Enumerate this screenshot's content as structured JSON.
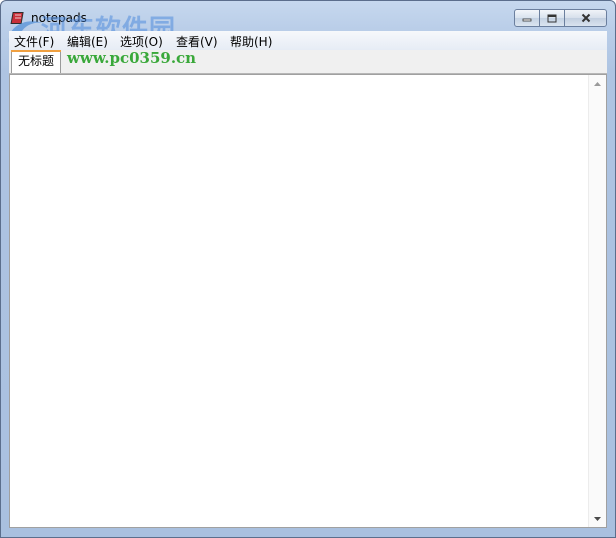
{
  "window": {
    "title": "notepads"
  },
  "watermark": {
    "brand": "河东软件园",
    "url": "www.pc0359.cn"
  },
  "menu": {
    "items": [
      {
        "label": "文件(F)"
      },
      {
        "label": "编辑(E)"
      },
      {
        "label": "选项(O)"
      },
      {
        "label": "查看(V)"
      },
      {
        "label": "帮助(H)"
      }
    ]
  },
  "tabs": [
    {
      "label": "无标题"
    }
  ],
  "editor": {
    "content": ""
  },
  "icons": {
    "app": "notepad-app-icon",
    "minimize": "minimize-icon",
    "maximize": "maximize-icon",
    "close": "close-icon",
    "scroll_up": "scroll-up-arrow-icon",
    "scroll_down": "scroll-down-arrow-icon"
  },
  "colors": {
    "tab_accent": "#f0a040",
    "watermark_url": "#3aa83a"
  }
}
